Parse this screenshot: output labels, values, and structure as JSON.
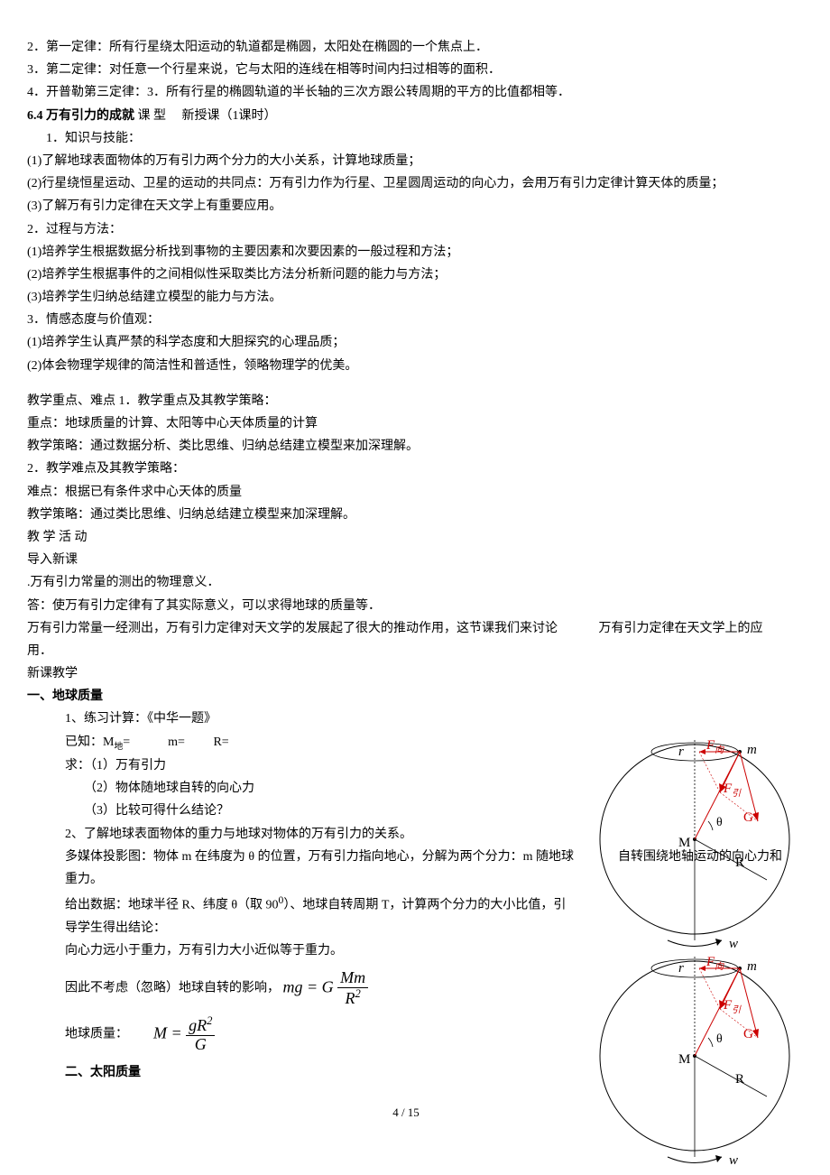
{
  "intro": {
    "l1": "2．第一定律：所有行星绕太阳运动的轨道都是椭圆，太阳处在椭圆的一个焦点上．",
    "l2": "3．第二定律：对任意一个行星来说，它与太阳的连线在相等时间内扫过相等的面积．",
    "l3": "4．开普勒第三定律：3．所有行星的椭圆轨道的半长轴的三次方跟公转周期的平方的比值都相等．"
  },
  "heading6_4": "6.4 万有引力的成就",
  "course_type_label": "课 型",
  "course_type_value": "新授课（1课时）",
  "s1": {
    "h": "1．知识与技能：",
    "p1": "(1)了解地球表面物体的万有引力两个分力的大小关系，计算地球质量；",
    "p2": "(2)行星绕恒星运动、卫星的运动的共同点：万有引力作为行星、卫星圆周运动的向心力，会用万有引力定律计算天体的质量；",
    "p3": "(3)了解万有引力定律在天文学上有重要应用。"
  },
  "s2": {
    "h": "2．过程与方法：",
    "p1": "(1)培养学生根据数据分析找到事物的主要因素和次要因素的一般过程和方法；",
    "p2": "(2)培养学生根据事件的之间相似性采取类比方法分析新问题的能力与方法；",
    "p3": "(3)培养学生归纳总结建立模型的能力与方法。"
  },
  "s3": {
    "h": "3．情感态度与价值观：",
    "p1": "(1)培养学生认真严禁的科学态度和大胆探究的心理品质；",
    "p2": "(2)体会物理学规律的简洁性和普适性，领略物理学的优美。"
  },
  "teaching_focus": {
    "h": "教学重点、难点   1．教学重点及其教学策略：",
    "p1": "重点：地球质量的计算、太阳等中心天体质量的计算",
    "p2": "教学策略：通过数据分析、类比思维、归纳总结建立模型来加深理解。",
    "h2": "2．教学难点及其教学策略：",
    "p3": "难点：根据已有条件求中心天体的质量",
    "p4": "教学策略：通过类比思维、归纳总结建立模型来加深理解。"
  },
  "activity": {
    "h": "教 学 活 动",
    "intro_h": "导入新课",
    "q": ".万有引力常量的测出的物理意义．",
    "a": "答：使万有引力定律有了其实际意义，可以求得地球的质量等．",
    "p1a": "万有引力常量一经测出，万有引力定律对天文学的发展起了很大的推动作用，这节课我们来讨论",
    "p1b": "万有引力定律在天文学上的应用．",
    "new_h": "新课教学"
  },
  "earth": {
    "h": "一、地球质量",
    "p1": "1、练习计算：《中华一题》",
    "given_label": "已知：M",
    "given_sub": "地",
    "given_eq": "=",
    "given_m": "m=",
    "given_R": "R=",
    "ask": "求：（1）万有引力",
    "ask2": "（2）物体随地球自转的向心力",
    "ask3": "（3）比较可得什么结论？",
    "p2": "2、了解地球表面物体的重力与地球对物体的万有引力的关系。",
    "p3a": "多媒体投影图：物体 m 在纬度为 θ 的位置，万有引力指向地心，分解为两个分力：m 随地球",
    "p3b": "自转围绕地轴运动的向心力和重力。",
    "p4a": "给出数据：地球半径 R、纬度 θ（取 90",
    "p4a_sup": "0",
    "p4a_end": "）、地球自转周期 T，计算两个分力的大小比值，引导学生得出结论：",
    "p5": "向心力远小于重力，万有引力大小近似等于重力。",
    "p6": "因此不考虑（忽略）地球自转的影响，",
    "f1_lhs": "mg = G",
    "f1_num": "Mm",
    "f1_den": "R",
    "f1_den_sup": "2",
    "mass_label": "地球质量：",
    "f2_lhs": "M =",
    "f2_num_a": "gR",
    "f2_num_sup": "2",
    "f2_den": "G"
  },
  "sun": {
    "h": "二、太阳质量"
  },
  "diagram": {
    "r": "r",
    "F_xiang": "F",
    "F_xiang_sub": "向",
    "m": "m",
    "F_yin": "F",
    "F_yin_sub": "引",
    "theta": "θ",
    "G": "G",
    "M": "M",
    "R": "R",
    "w": "w"
  },
  "footer": "4  /  15"
}
